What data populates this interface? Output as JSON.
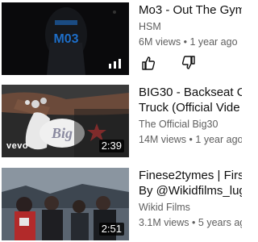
{
  "videos": [
    {
      "title": "Mo3 - Out The Gym",
      "channel": "HSM",
      "views": "6M views",
      "age": "1 year ago",
      "separator": "•",
      "badge_icon": "live-bars-icon"
    },
    {
      "title_line1": "BIG30 - Backseat O",
      "title_line2": "Truck (Official Vide",
      "channel": "The Official Big30",
      "views": "14M views",
      "age": "1 year ago",
      "separator": "•",
      "duration": "2:39",
      "overlay_text": "vevo"
    },
    {
      "title_line1": "Finese2tymes | Firs",
      "title_line2": "By @Wikidfilms_lug",
      "channel": "Wikid Films",
      "views": "3.1M views",
      "age": "5 years ag",
      "separator": "•",
      "duration": "2:51"
    }
  ],
  "actions": {
    "like_icon": "thumb-up-icon",
    "dislike_icon": "thumb-down-icon"
  },
  "colors": {
    "title": "#0f0f0f",
    "meta": "#606060",
    "thumb_blue": "#1e6ec8"
  }
}
